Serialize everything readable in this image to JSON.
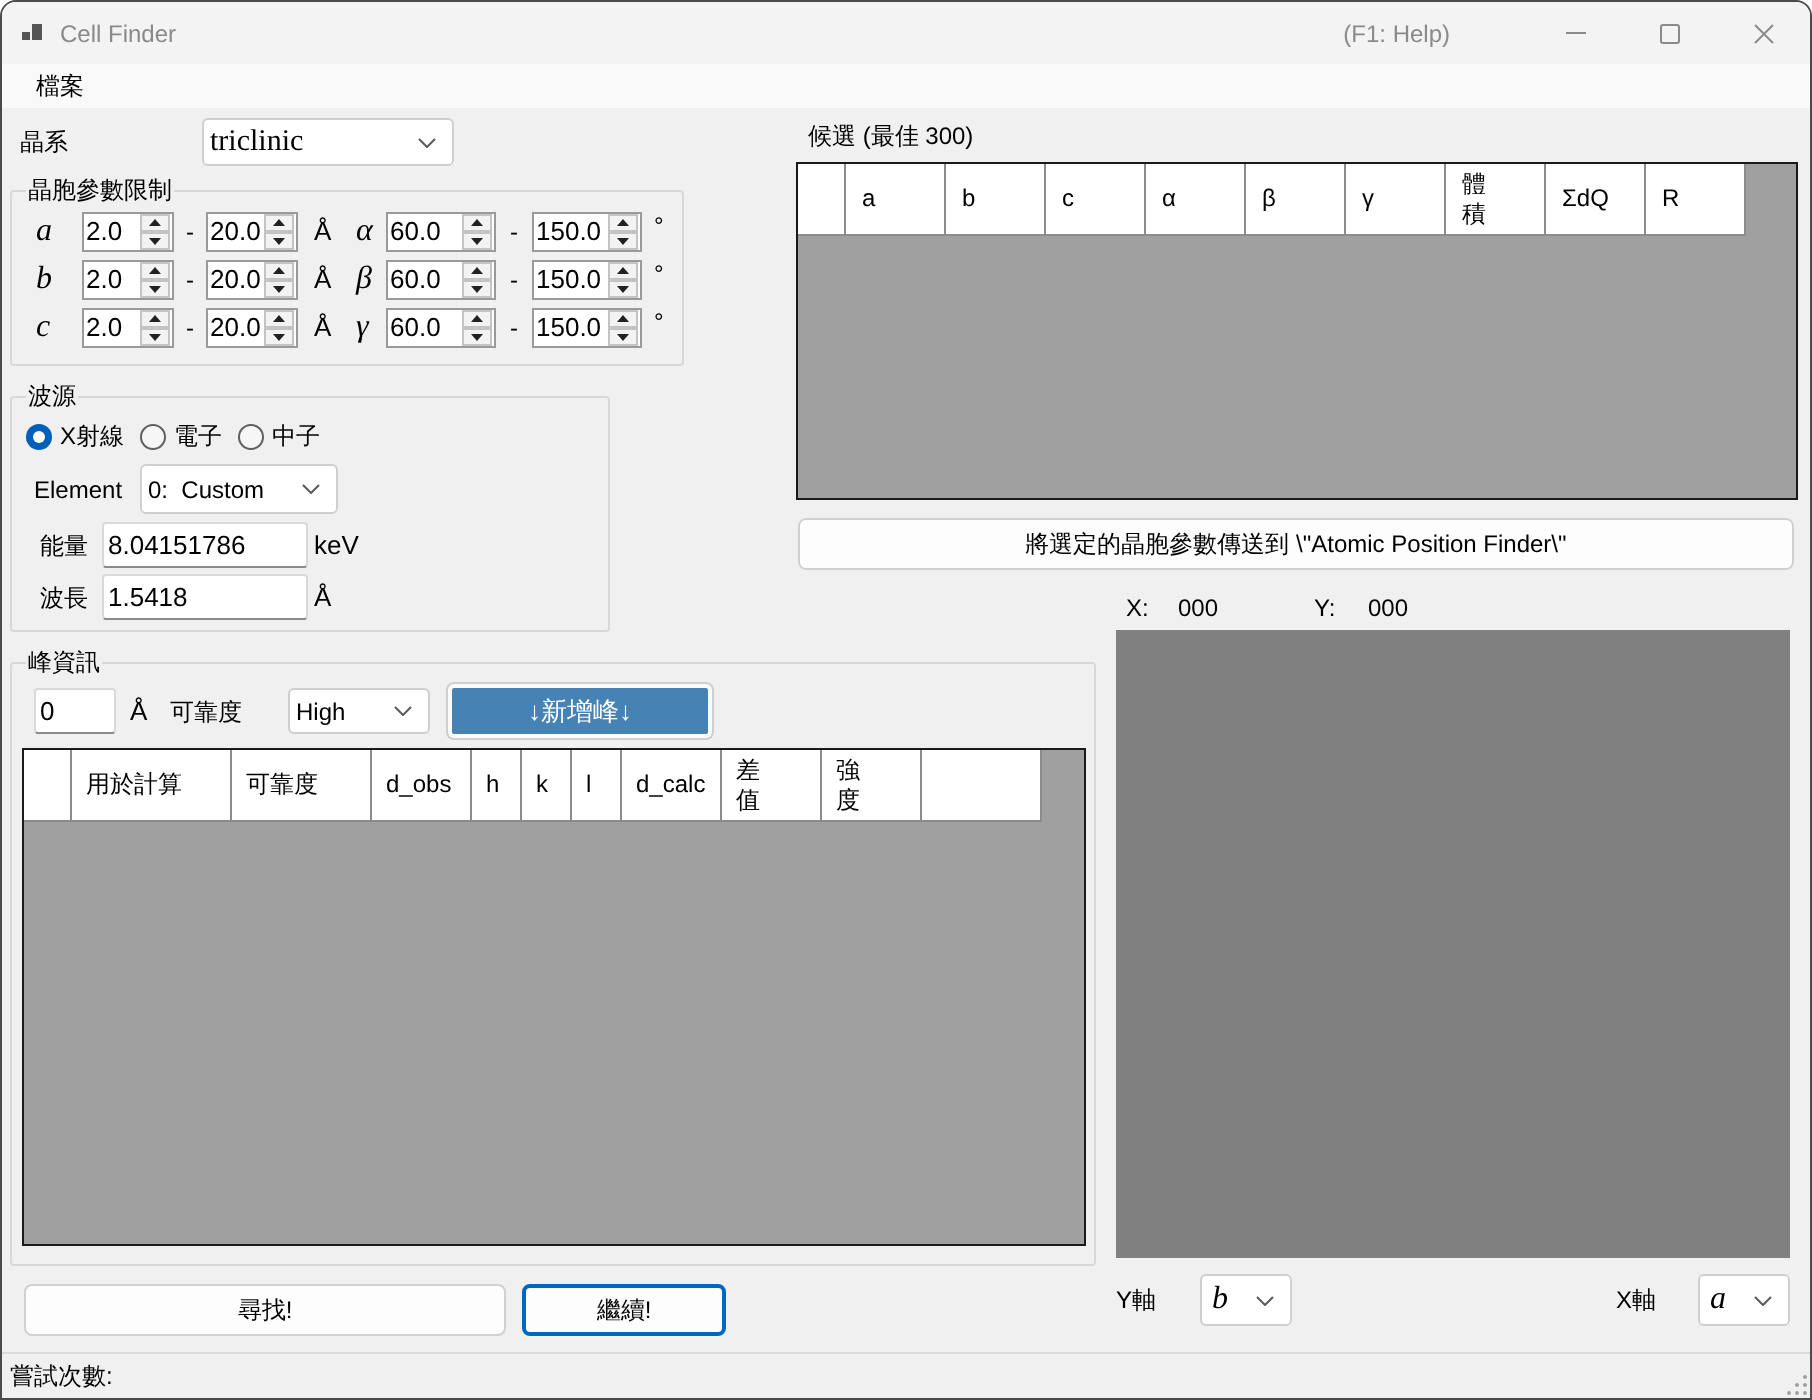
{
  "window": {
    "title": "Cell Finder",
    "help_hint": "(F1: Help)"
  },
  "menu": [
    {
      "label": "檔案"
    }
  ],
  "crystal_system": {
    "label": "晶系",
    "value": "triclinic"
  },
  "cell_limits": {
    "title": "晶胞參數限制",
    "rows": [
      {
        "length_label": "a",
        "length_min": "2.0",
        "length_dash": "-",
        "length_max": "20.0",
        "length_unit": "Å",
        "angle_label": "α",
        "angle_min": "60.0",
        "angle_dash": "-",
        "angle_max": "150.0",
        "angle_unit": "°"
      },
      {
        "length_label": "b",
        "length_min": "2.0",
        "length_dash": "-",
        "length_max": "20.0",
        "length_unit": "Å",
        "angle_label": "β",
        "angle_min": "60.0",
        "angle_dash": "-",
        "angle_max": "150.0",
        "angle_unit": "°"
      },
      {
        "length_label": "c",
        "length_min": "2.0",
        "length_dash": "-",
        "length_max": "20.0",
        "length_unit": "Å",
        "angle_label": "γ",
        "angle_min": "60.0",
        "angle_dash": "-",
        "angle_max": "150.0",
        "angle_unit": "°"
      }
    ]
  },
  "candidates": {
    "title": "候選 (最佳 300)",
    "table": {
      "columns": [
        "a",
        "b",
        "c",
        "α",
        "β",
        "γ",
        "體積",
        "ΣdQ",
        "R"
      ]
    },
    "send_button": "將選定的晶胞參數傳送到 \\\"Atomic Position Finder\\\""
  },
  "source": {
    "title": "波源",
    "radios": [
      {
        "label": "X射線",
        "selected": true
      },
      {
        "label": "電子",
        "selected": false
      },
      {
        "label": "中子",
        "selected": false
      }
    ],
    "element": {
      "label": "Element",
      "value": "0:  Custom"
    },
    "energy": {
      "label": "能量",
      "value": "8.04151786",
      "unit": "keV"
    },
    "wavelength": {
      "label": "波長",
      "value": "1.5418",
      "unit": "Å"
    }
  },
  "plot": {
    "x_label": "X:",
    "x_value": "000",
    "y_label": "Y:",
    "y_value": "000",
    "y_axis": {
      "label": "Y軸",
      "value": "b"
    },
    "x_axis": {
      "label": "X軸",
      "value": "a"
    }
  },
  "peaks": {
    "title": "峰資訊",
    "d_value": "0",
    "d_unit": "Å",
    "reliability_label": "可靠度",
    "reliability_value": "High",
    "add_button": "↓新增峰↓",
    "table": {
      "columns": [
        "用於計算",
        "可靠度",
        "d_obs",
        "h",
        "k",
        "l",
        "d_calc",
        "差值",
        "強度"
      ]
    }
  },
  "actions": [
    {
      "label": "尋找!",
      "focused": false
    },
    {
      "label": "繼續!",
      "focused": true
    }
  ],
  "status_bar": {
    "text": "嘗試次數:"
  }
}
